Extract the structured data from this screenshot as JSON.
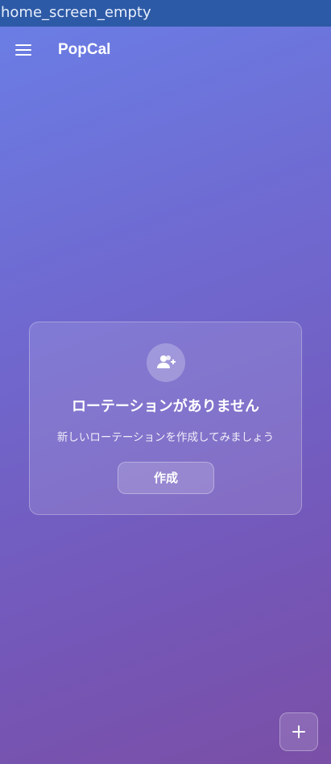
{
  "window": {
    "title": "home_screen_empty"
  },
  "appbar": {
    "title": "PopCal",
    "menu_icon": "hamburger-menu-icon"
  },
  "empty_state": {
    "icon": "add-group-icon",
    "title": "ローテーションがありません",
    "subtitle": "新しいローテーションを作成してみましょう",
    "create_label": "作成"
  },
  "fab": {
    "icon": "plus-icon"
  },
  "colors": {
    "statusbar": "#2d5aa6",
    "gradient_top": "#6a7fe6",
    "gradient_bottom": "#7a4fa6",
    "text": "#ffffff"
  }
}
